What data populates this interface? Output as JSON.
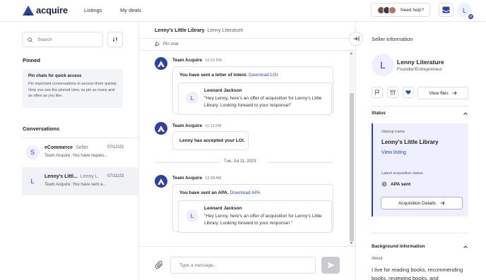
{
  "nav": {
    "logo_text": "acquire",
    "links": [
      "Listings",
      "My deals"
    ],
    "help_label": "Need help?",
    "user_initial": "L",
    "user_badge": "M"
  },
  "sidebar": {
    "search_placeholder": "Search",
    "pinned_title": "Pinned",
    "pin_tip_title": "Pin chats for quick access",
    "pin_tip_body": "Pin important conversations to access them quickly. Only you see the pinned view, so pin as many and as often as you like.",
    "conversations_title": "Conversations",
    "conversations": [
      {
        "initial": "S",
        "name": "eCommerce",
        "role": "Seller",
        "date": "07/12/23",
        "preview": "Team Acquire: You have reques...",
        "active": false
      },
      {
        "initial": "L",
        "name": "Lenny's Littl...",
        "role": "Lenny L.",
        "date": "07/11/23",
        "preview": "Team Acquire: You have sent a...",
        "active": true
      }
    ]
  },
  "chat": {
    "title": "Lenny's Little Library",
    "subtitle": "Lenny Literature",
    "pin_label": "Pin chat",
    "messages": [
      {
        "sender": "Team Acquire",
        "time": "10:23 PM",
        "text": "You have sent a letter of intent.",
        "link": "Download LOI",
        "quote_initial": "L",
        "quote_name": "Leonard Jackson",
        "quote_body": "\"Hey Lenny, here's an offer of acquisition for Lenny's Little Library. Looking forward to your response!\""
      },
      {
        "sender": "Team Acquire",
        "time": "11:13 PM",
        "text": "Lenny has accepted your LOI."
      },
      {
        "sender": "Team Acquire",
        "time": "12:28 AM",
        "text": "You have sent an APA.",
        "link": "Download APA",
        "quote_initial": "L",
        "quote_name": "Leonard Jackson",
        "quote_body": "\"Hey Lenny, here's an offer of acquisition for Lenny's Little Library. Looking forward to your response! \""
      }
    ],
    "date_separator": "Tue, Jul 11, 2023",
    "input_placeholder": "Type a message..."
  },
  "seller": {
    "panel_title": "Seller information",
    "initial": "L",
    "name": "Lenny Literature",
    "role": "Founder/Entrepreneur",
    "view_files": "View files",
    "status_title": "Status",
    "startup_label": "Startup name",
    "startup_name": "Lenny's Little Library",
    "view_listing": "View listing",
    "acq_status_label": "Latest acquisition status",
    "acq_status": "APA sent",
    "acq_details": "Acquisition Details",
    "background_title": "Background information",
    "about_label": "About",
    "about_text": "I live for reading books, recommending books, reviewing books, and"
  },
  "colors": {
    "brand": "#2a3fb0",
    "link": "#2a48c9",
    "heart": "#2a48c9"
  },
  "icons": [
    "logo-icon",
    "inbox-icon",
    "search-icon",
    "filter-icon",
    "pin-icon",
    "collapse-panel-icon",
    "team-acquire-icon",
    "attach-icon",
    "send-icon",
    "flag-icon",
    "archive-icon",
    "heart-icon",
    "arrow-right-icon",
    "chevron-up-icon",
    "status-dot-icon"
  ]
}
